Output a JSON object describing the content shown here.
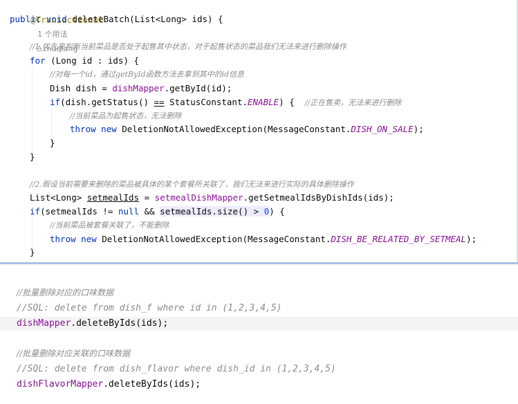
{
  "top": {
    "annotation": "@Transactional",
    "usages": "1 个用法",
    "author": "zhuqiang",
    "sig": {
      "kw1": "public",
      "kw2": "void",
      "name": "deleteBatch(List<Long> ids) {"
    },
    "c1": "//1.优先来判断当前菜品是否处于起售其中状态，对于起售状态的菜品我们无法来进行删除操作",
    "for_kw": "for",
    "for_rest": " (Long id : ids) {",
    "c2": "//对每一个id，通过getById函数方法去拿到其中的id信息",
    "dish_a": "Dish dish = ",
    "dish_field": "dishMapper",
    "dish_b": ".getById(id);",
    "if1_kw": "if",
    "if1_a": "(dish.getStatus() ",
    "if1_eq": "==",
    "if1_b": " StatusConstant.",
    "enable": "ENABLE",
    "if1_c": ") {  ",
    "c3": "//正在售卖，无法来进行删除",
    "c4": "//当前菜品为起售状态，无法删除",
    "throw_kw": "throw",
    "new_kw": "new",
    "exc1_a": " DeletionNotAllowedException(MessageConstant.",
    "dish_on_sale": "DISH_ON_SALE",
    "exc1_b": ");",
    "brace": "}",
    "c5": "//2.假设当前需要来删除的菜品被具体的某个套餐所关联了，我们无法来进行实际的具体删除操作",
    "list_a": "List<Long> ",
    "list_var": "setmealIds",
    "list_b": " = ",
    "list_field": "setmealDishMapper",
    "list_c": ".getSetmealIdsByDishIds(ids);",
    "if2_kw": "if",
    "if2_a": "(setmealIds != ",
    "null_kw": "null",
    "if2_b": " && ",
    "if2_hl": "setmealIds.size() > ",
    "zero": "0",
    "if2_c": ") {",
    "c6": "//当前菜品被套餐关联了，不能删除",
    "exc2_a": " DeletionNotAllowedException(MessageConstant.",
    "related": "DISH_BE_RELATED_BY_SETMEAL",
    "exc2_b": ");"
  },
  "bottom": {
    "c1": "//批量删除对应的口味数据",
    "c2": "//SQL: delete from dish_f where id in (1,2,3,4,5)",
    "call1_field": "dishMapper",
    "call1_rest": ".deleteByIds(ids);",
    "c3": "//批量删除对应关联的口味数据",
    "c4": "//SQL: delete from dish_flavor where dish_id in (1,2,3,4,5)",
    "call2_field": "dishFlavorMapper",
    "call2_rest": ".deleteByIds(ids);"
  }
}
